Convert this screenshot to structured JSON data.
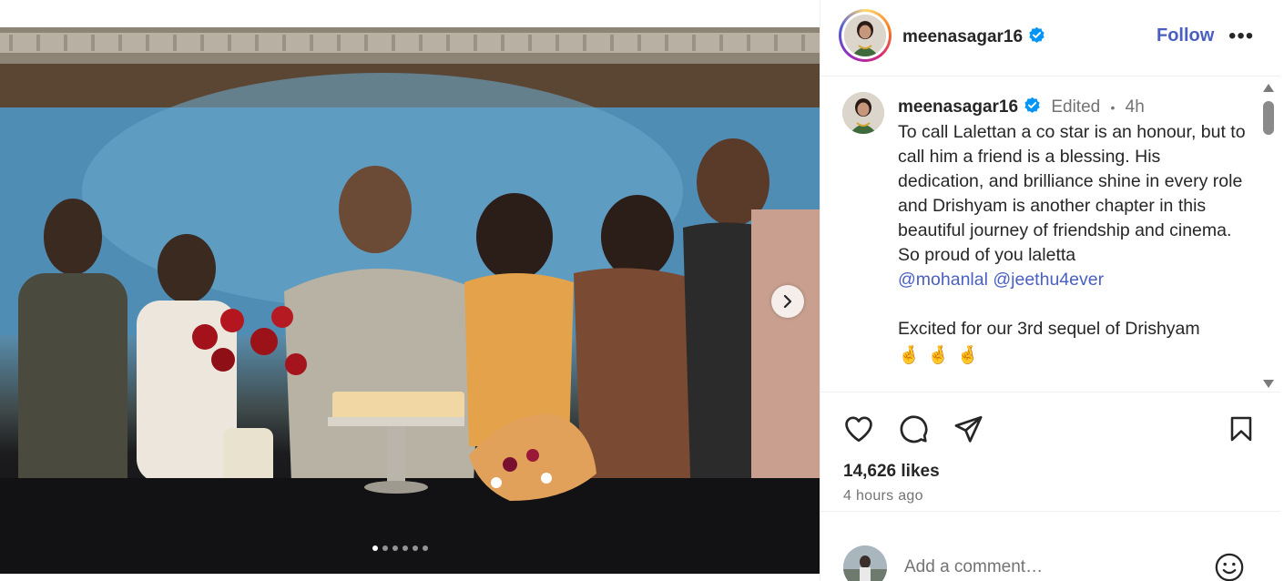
{
  "post": {
    "username": "meenasagar16",
    "verified": true,
    "follow_label": "Follow",
    "more_label": "•••",
    "caption": {
      "edited_label": "Edited",
      "separator": "•",
      "age": "4h",
      "text": "To call Lalettan a co star is an honour, but to call him a friend is a blessing. His dedication, and brilliance shine in every role and Drishyam is another chapter in this beautiful journey of friendship and cinema. So proud of you laletta",
      "mentions": [
        "@mohanlal",
        "@jeethu4ever"
      ],
      "paragraph2": "Excited for our 3rd sequel of Drishyam",
      "emojis": [
        "🤞",
        "🤞",
        "🤞"
      ]
    },
    "likes": "14,626 likes",
    "timestamp": "4 hours ago",
    "comment_placeholder": "Add a comment…"
  },
  "carousel": {
    "total_slides": 6,
    "active_index": 0
  },
  "colors": {
    "link": "#4a5fc1",
    "verified": "#0095f6",
    "muted": "#737373",
    "text": "#262626"
  },
  "icons": {
    "like": "heart-icon",
    "comment": "comment-icon",
    "share": "share-icon",
    "save": "bookmark-icon",
    "verified": "verified-badge-icon",
    "next": "chevron-right-icon",
    "emoji": "smiley-icon"
  }
}
